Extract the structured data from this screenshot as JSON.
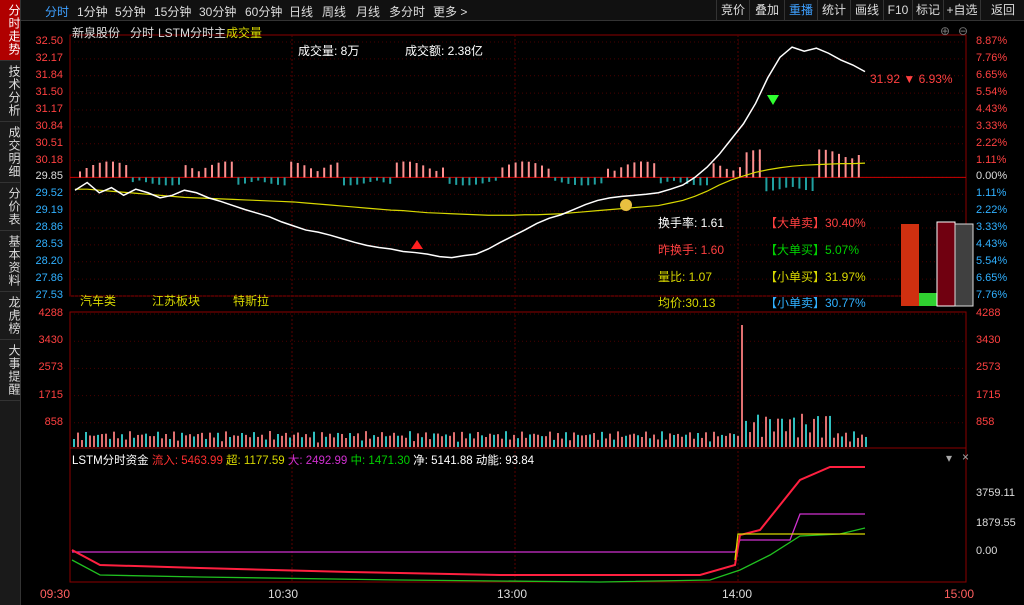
{
  "sidebar": [
    "分时走势",
    "技术分析",
    "成交明细",
    "分价表",
    "基本资料",
    "龙虎榜",
    "大事提醒"
  ],
  "periods": [
    "分时",
    "1分钟",
    "5分钟",
    "15分钟",
    "30分钟",
    "60分钟",
    "日线",
    "周线",
    "月线",
    "多分时",
    "更多 >"
  ],
  "toolbar": [
    "竞价",
    "叠加",
    "重播",
    "统计",
    "画线",
    "F10",
    "标记",
    "+自选",
    "返回"
  ],
  "header": {
    "stock": "新泉股份",
    "mode": "分时",
    "indicator": "LSTM分时主",
    "volume_label": "成交量"
  },
  "info": {
    "volume": "成交量: 8万",
    "amount": "成交额: 2.38亿"
  },
  "price_axis": [
    "32.50",
    "32.17",
    "31.84",
    "31.50",
    "31.17",
    "30.84",
    "30.51",
    "30.18",
    "29.85",
    "29.52",
    "29.19",
    "28.86",
    "28.53",
    "28.20",
    "27.86",
    "27.53"
  ],
  "pct_axis": [
    "8.87%",
    "7.76%",
    "6.65%",
    "5.54%",
    "4.43%",
    "3.33%",
    "2.22%",
    "1.11%",
    "0.00%",
    "1.11%",
    "2.22%",
    "3.33%",
    "4.43%",
    "5.54%",
    "6.65%",
    "7.76%"
  ],
  "current": "31.92 ▼ 6.93%",
  "stats_left": [
    "换手率: 1.61",
    "昨换手: 1.60",
    "量比: 1.07",
    "均价:30.13"
  ],
  "stats_right": [
    "【大单卖】30.40%",
    "【大单买】5.07%",
    "【小单买】31.97%",
    "【小单卖】30.77%"
  ],
  "tags": [
    "汽车类",
    "江苏板块",
    "特斯拉"
  ],
  "vol_axis": [
    "4288",
    "3430",
    "2573",
    "1715",
    "858"
  ],
  "fund": {
    "title": "LSTM分时资金",
    "items": [
      "流入: 5463.99",
      "超: 1177.59",
      "大: 2492.99",
      "中: 1471.30",
      "净: 5141.88",
      "动能: 93.84"
    ]
  },
  "fund_axis": [
    "3759.11",
    "1879.55",
    "0.00"
  ],
  "time_axis": [
    "09:30",
    "10:30",
    "13:00",
    "14:00",
    "15:00"
  ],
  "colors": {
    "up": "#ff3030",
    "down": "#00c8c8",
    "price": "#ffffff",
    "avg": "#d8d800",
    "green": "#00d000",
    "magenta": "#d030d0"
  },
  "chart_data": {
    "type": "line",
    "prev_close": 29.85,
    "price": [
      29.6,
      29.75,
      29.55,
      29.65,
      29.5,
      29.62,
      29.55,
      29.45,
      29.5,
      29.6,
      29.55,
      29.45,
      29.38,
      29.3,
      29.22,
      29.15,
      29.08,
      28.98,
      28.9,
      28.82,
      28.78,
      28.72,
      28.65,
      28.58,
      28.52,
      28.48,
      28.45,
      28.4,
      28.38,
      28.35,
      28.3,
      28.28,
      28.32,
      28.35,
      28.45,
      28.58,
      28.7,
      28.82,
      28.95,
      29.05,
      29.12,
      29.22,
      29.32,
      29.4,
      29.45,
      29.48,
      29.5,
      29.52,
      29.55,
      29.62,
      29.7,
      29.85,
      30.05,
      30.3,
      30.6,
      30.9,
      31.3,
      31.8,
      32.2,
      32.4,
      32.32,
      32.38,
      32.28,
      32.15,
      32.05,
      31.92
    ],
    "avg": [
      29.62,
      29.62,
      29.6,
      29.58,
      29.56,
      29.54,
      29.52,
      29.5,
      29.48,
      29.46,
      29.45,
      29.44,
      29.43,
      29.42,
      29.41,
      29.4,
      29.39,
      29.38,
      29.37,
      29.35,
      29.33,
      29.31,
      29.29,
      29.27,
      29.25,
      29.23,
      29.21,
      29.2,
      29.18,
      29.16,
      29.15,
      29.14,
      29.13,
      29.12,
      29.11,
      29.11,
      29.11,
      29.12,
      29.12,
      29.13,
      29.14,
      29.16,
      29.18,
      29.2,
      29.22,
      29.24,
      29.26,
      29.28,
      29.3,
      29.35,
      29.4,
      29.48,
      29.58,
      29.7,
      29.8,
      29.88,
      29.95,
      30.0,
      30.04,
      30.07,
      30.09,
      30.1,
      30.11,
      30.12,
      30.12,
      30.13
    ]
  }
}
